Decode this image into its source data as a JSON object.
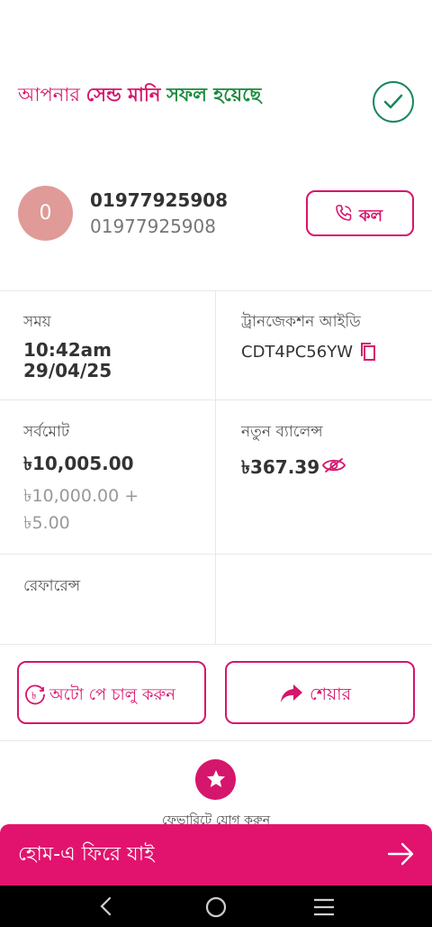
{
  "header": {
    "title_part1": "আপনার ",
    "title_part2": "সেন্ড মানি",
    "title_part3": "সফল হয়েছে",
    "success_icon": "checkmark-circle-icon"
  },
  "contact": {
    "avatar_letter": "0",
    "name": "01977925908",
    "number": "01977925908",
    "call_label": "কল",
    "call_icon": "phone-icon"
  },
  "details": {
    "time_label": "সময়",
    "time_value": "10:42am",
    "date_value": "29/04/25",
    "trx_label": "ট্রানজেকশন আইডি",
    "trx_value": "CDT4PC56YW",
    "total_label": "সর্বমোট",
    "total_value": "৳10,005.00",
    "breakdown_amount": "৳10,000.00 +",
    "breakdown_fee": "৳5.00",
    "balance_label": "নতুন ব্যালেন্স",
    "balance_value": "৳367.39",
    "reference_label": "রেফারেন্স"
  },
  "actions": {
    "autopay_label": "অটো পে চালু করুন",
    "share_label": "শেয়ার"
  },
  "favorite": {
    "icon": "star-icon",
    "text": "ফেভারিটে যোগ করুন"
  },
  "footer": {
    "home_label": "হোম-এ ফিরে যাই"
  },
  "colors": {
    "brand": "#e2136e",
    "success": "#1d8a3e"
  }
}
